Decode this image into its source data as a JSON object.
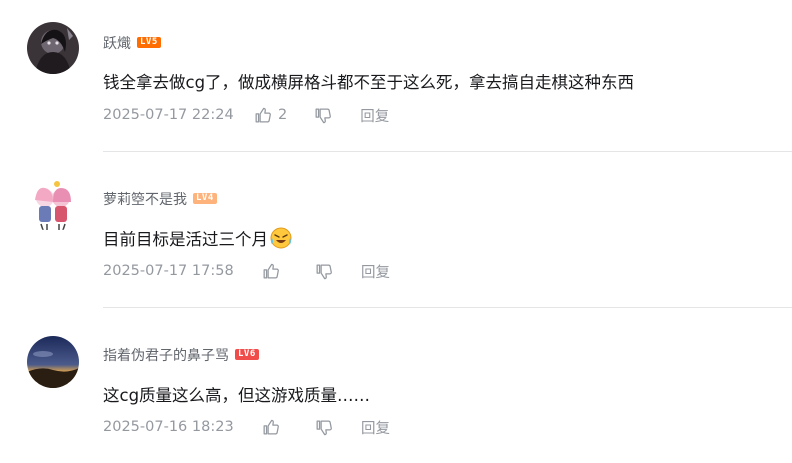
{
  "comments": [
    {
      "username": "跃熾",
      "level": "LV5",
      "level_color": "#ff6c00",
      "content": "钱全拿去做cg了，做成横屏格斗都不至于这么死，拿去搞自走棋这种东西",
      "time": "2025-07-17 22:24",
      "likes": "2",
      "reply_label": "回复"
    },
    {
      "username": "萝莉箜不是我",
      "level": "LV4",
      "level_color": "#ffb37c",
      "content": "目前目标是活过三个月",
      "emoji": "crying-laughing-emoji",
      "time": "2025-07-17 17:58",
      "likes": "",
      "reply_label": "回复"
    },
    {
      "username": "指着伪君子的鼻子骂",
      "level": "LV6",
      "level_color": "#f04c49",
      "content": "这cg质量这么高，但这游戏质量……",
      "time": "2025-07-16 18:23",
      "likes": "",
      "reply_label": "回复"
    }
  ]
}
